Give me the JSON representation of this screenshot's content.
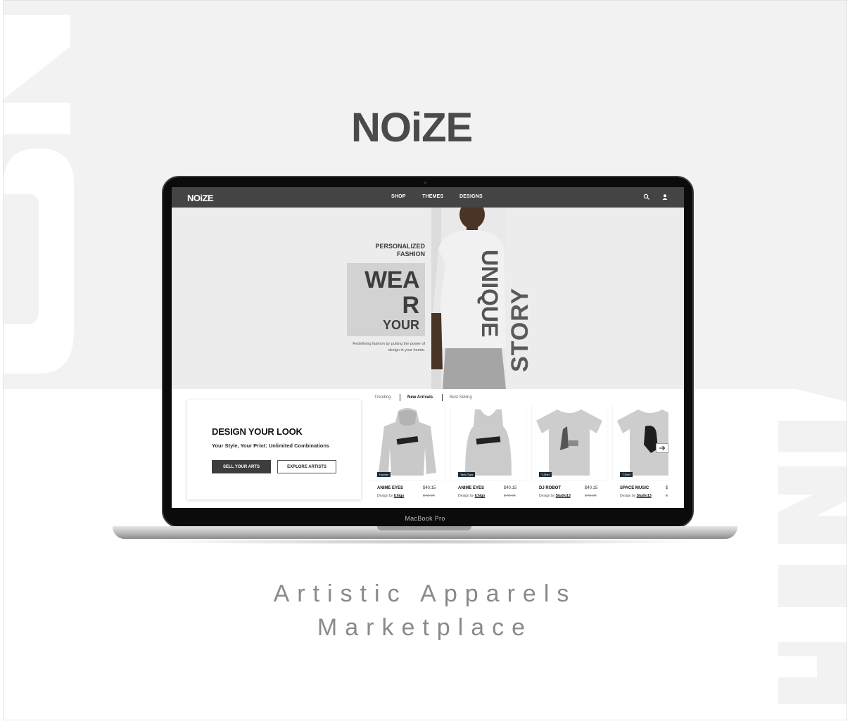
{
  "brand": {
    "name": "NOiZE"
  },
  "site": {
    "nav": {
      "links": [
        "SHOP",
        "THEMES",
        "DESIGNS"
      ],
      "icons": [
        "search-icon",
        "user-icon"
      ]
    },
    "hero": {
      "kicker": [
        "PERSONALIZED",
        "FASHION"
      ],
      "headline_lines": [
        "WEA",
        "R",
        "YOUR"
      ],
      "vertical_words": [
        "UNIQUE",
        "STORY"
      ],
      "description": "Redefining fashion by putting the power of design in your hands."
    },
    "promo": {
      "title": "DESIGN YOUR LOOK",
      "subtitle": "Your Style, Your Print: Unlimited Combinations",
      "primary_button": "SELL YOUR ARTS",
      "secondary_button": "EXPLORE ARTISTS"
    },
    "filters": {
      "tabs": [
        "Trending",
        "New Arrivals",
        "Best Selling"
      ],
      "active": "New Arrivals"
    },
    "products": [
      {
        "name": "ANIME EYES",
        "price": "$40.15",
        "old_price": "$48.95",
        "design_prefix": "Design by",
        "artist": "Ichigo",
        "badge": "Hoodie"
      },
      {
        "name": "ANIME EYES",
        "price": "$40.15",
        "old_price": "$48.95",
        "design_prefix": "Design by",
        "artist": "Ichigo",
        "badge": "Tank-Tops"
      },
      {
        "name": "DJ ROBOT",
        "price": "$40.15",
        "old_price": "$48.95",
        "design_prefix": "Design by",
        "artist": "Studio13",
        "badge": "T-Shirt"
      },
      {
        "name": "SPACE MUSIC",
        "price": "$",
        "old_price": "$",
        "design_prefix": "Design by",
        "artist": "Studio13",
        "badge": "T-Shirt"
      }
    ]
  },
  "device_label": "MacBook Pro",
  "tagline": [
    "Artistic Apparels",
    "Marketplace"
  ],
  "colors": {
    "nav_bg": "#444444",
    "hero_bg": "#ececec",
    "accent_dark": "#3d3d3d",
    "badge": "#1f2d3a"
  }
}
